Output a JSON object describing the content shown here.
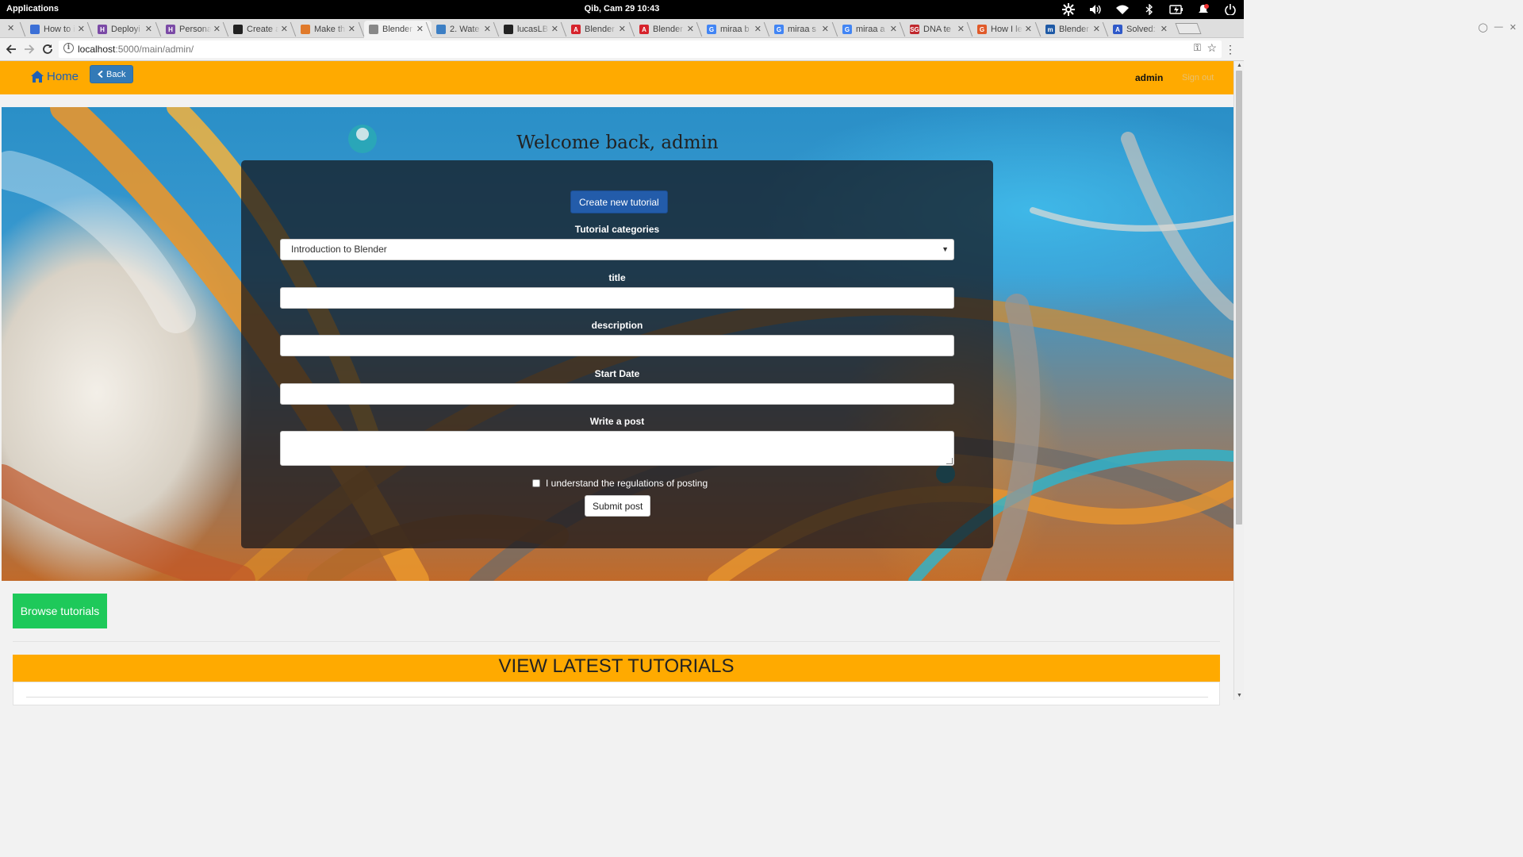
{
  "os": {
    "applications_label": "Applications",
    "datetime": "Qib, Cam 29   10:43",
    "tray_icons": [
      "network-settings-icon",
      "volume-icon",
      "wifi-icon",
      "bluetooth-icon",
      "battery-icon",
      "notification-icon",
      "power-icon"
    ]
  },
  "browser": {
    "tabs": [
      {
        "title": "How to i",
        "favicon_color": "#3b6fd6",
        "favicon": "grid-icon"
      },
      {
        "title": "Deployi",
        "favicon_color": "#7b4aa6",
        "favicon": "H"
      },
      {
        "title": "Persona",
        "favicon_color": "#7b4aa6",
        "favicon": "H"
      },
      {
        "title": "Create a",
        "favicon_color": "#222222",
        "favicon": "github-icon"
      },
      {
        "title": "Make th",
        "favicon_color": "#e07a2b",
        "favicon": "stackoverflow-icon"
      },
      {
        "title": "Blender",
        "favicon_color": "#888888",
        "favicon": "page-icon",
        "active": true
      },
      {
        "title": "2. Wate",
        "favicon_color": "#3d7fc4",
        "favicon": "globe-icon"
      },
      {
        "title": "lucasLB",
        "favicon_color": "#222222",
        "favicon": "github-icon"
      },
      {
        "title": "Blender",
        "favicon_color": "#d6232c",
        "favicon": "A"
      },
      {
        "title": "Blender",
        "favicon_color": "#d6232c",
        "favicon": "A"
      },
      {
        "title": "miraa b",
        "favicon_color": "#4285f4",
        "favicon": "G"
      },
      {
        "title": "miraa s",
        "favicon_color": "#4285f4",
        "favicon": "G"
      },
      {
        "title": "miraa a",
        "favicon_color": "#4285f4",
        "favicon": "G"
      },
      {
        "title": "DNA te",
        "favicon_color": "#c0282d",
        "favicon": "SG"
      },
      {
        "title": "How I le",
        "favicon_color": "#e05a2a",
        "favicon": "G"
      },
      {
        "title": "Blender",
        "favicon_color": "#1f5aa6",
        "favicon": "m"
      },
      {
        "title": "Solved:",
        "favicon_color": "#2f59c9",
        "favicon": "A"
      }
    ],
    "url_host": "localhost",
    "url_path": ":5000/main/admin/"
  },
  "site_nav": {
    "home_label": "Home",
    "back_label": "Back",
    "user": "admin",
    "signout_label": "Sign out"
  },
  "hero": {
    "welcome": "Welcome back, admin",
    "create_button": "Create new tutorial",
    "form": {
      "category_label": "Tutorial categories",
      "category_value": "Introduction to Blender",
      "title_label": "title",
      "title_value": "",
      "description_label": "description",
      "description_value": "",
      "start_date_label": "Start Date",
      "start_date_value": "",
      "post_label": "Write a post",
      "post_value": "",
      "agree_label": "I understand the regulations of posting",
      "agree_checked": false,
      "submit_label": "Submit post"
    }
  },
  "browse_button": "Browse tutorials",
  "latest_heading": "VIEW LATEST TUTORIALS",
  "colors": {
    "navbar": "#ffaa00",
    "back_button": "#337ab7",
    "create_button": "#235caa",
    "browse_button": "#1ec95a"
  }
}
